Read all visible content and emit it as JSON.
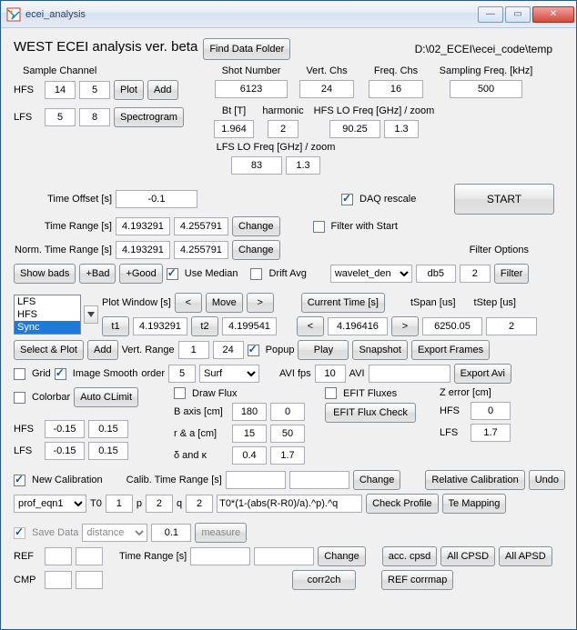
{
  "window": {
    "title": "ecei_analysis"
  },
  "header": {
    "title": "WEST ECEI analysis ver. beta",
    "find_folder": "Find Data Folder",
    "path": "D:\\02_ECEI\\ecei_code\\temp"
  },
  "sample": {
    "label": "Sample Channel",
    "hfs_label": "HFS",
    "hfs1": "14",
    "hfs2": "5",
    "lfs_label": "LFS",
    "lfs1": "5",
    "lfs2": "8",
    "plot": "Plot",
    "add": "Add",
    "spectrogram": "Spectrogram"
  },
  "top": {
    "shot_label": "Shot Number",
    "shot": "6123",
    "vert_label": "Vert. Chs",
    "vert": "24",
    "freq_label": "Freq. Chs",
    "freq": "16",
    "samp_label": "Sampling Freq. [kHz]",
    "samp": "500",
    "bt_label": "Bt [T]",
    "bt": "1.964",
    "harm_label": "harmonic",
    "harm": "2",
    "hfslo_label": "HFS LO Freq [GHz] / zoom",
    "hfslo": "90.25",
    "hfszoom": "1.3",
    "lfslo_label": "LFS LO Freq [GHz] / zoom",
    "lfslo": "83",
    "lfszoom": "1.3"
  },
  "time": {
    "offset_label": "Time Offset [s]",
    "offset": "-0.1",
    "range_label": "Time Range [s]",
    "r1": "4.193291",
    "r2": "4.255791",
    "change": "Change",
    "norm_label": "Norm. Time Range [s]",
    "n1": "4.193291",
    "n2": "4.255791"
  },
  "daq": {
    "rescale": "DAQ rescale",
    "filter_start": "Filter with Start",
    "start": "START"
  },
  "filter": {
    "showbads": "Show bads",
    "plusbad": "+Bad",
    "plusgood": "+Good",
    "use_median": "Use Median",
    "drift_avg": "Drift Avg",
    "options_label": "Filter Options",
    "method": "wavelet_den",
    "param": "db5",
    "n": "2",
    "filter": "Filter"
  },
  "plot": {
    "list": [
      "LFS",
      "HFS",
      "Sync"
    ],
    "window_label": "Plot Window [s]",
    "prev": "<",
    "move": "Move",
    "next": ">",
    "t1_label": "t1",
    "t1": "4.193291",
    "t2_label": "t2",
    "t2": "4.199541",
    "current_label": "Current Time [s]",
    "cur_prev": "<",
    "cur": "4.196416",
    "cur_next": ">",
    "tspan_label": "tSpan [us]",
    "tspan": "6250.05",
    "tstep_label": "tStep [us]",
    "tstep": "2",
    "select_plot": "Select & Plot",
    "add": "Add",
    "vrange_label": "Vert. Range",
    "v1": "1",
    "v2": "24",
    "popup": "Popup",
    "play": "Play",
    "snapshot": "Snapshot",
    "export_frames": "Export Frames",
    "grid": "Grid",
    "smooth": "Image Smooth",
    "order_label": "order",
    "order": "5",
    "surf": "Surf",
    "avifps_label": "AVI fps",
    "avifps": "10",
    "avi_label": "AVI",
    "avi": "",
    "export_avi": "Export Avi",
    "colorbar": "Colorbar",
    "autoclimit": "Auto CLimit",
    "hfs_label": "HFS",
    "h1": "-0.15",
    "h2": "0.15",
    "lfs_label": "LFS",
    "l1": "-0.15",
    "l2": "0.15"
  },
  "flux": {
    "draw": "Draw Flux",
    "efit": "EFIT Fluxes",
    "check": "EFIT Flux Check",
    "baxis_label": "B axis [cm]",
    "b1": "180",
    "b2": "0",
    "ra_label": "r & a [cm]",
    "r1": "15",
    "r2": "50",
    "dk_label": "δ and κ",
    "d1": "0.4",
    "d2": "1.7",
    "zerr_label": "Z error [cm]",
    "zh": "0",
    "zl": "1.7",
    "hfs": "HFS",
    "lfs": "LFS"
  },
  "calib": {
    "new": "New Calibration",
    "range_label": "Calib. Time Range [s]",
    "c1": "",
    "c2": "",
    "change": "Change",
    "rel": "Relative Calibration",
    "undo": "Undo",
    "prof": "prof_eqn1",
    "t0_label": "T0",
    "t0": "1",
    "p_label": "p",
    "p": "2",
    "q_label": "q",
    "q": "2",
    "eqn": "T0*(1-(abs(R-R0)/a).^p).^q",
    "check": "Check Profile",
    "te": "Te Mapping"
  },
  "save": {
    "save": "Save Data",
    "mode": "distance",
    "val": "0.1",
    "measure": "measure",
    "ref_label": "REF",
    "cmp_label": "CMP",
    "tr_label": "Time Range [s]",
    "t1": "",
    "t2": "",
    "change": "Change",
    "acc": "acc. cpsd",
    "allcpsd": "All CPSD",
    "allapsd": "All APSD",
    "corr2ch": "corr2ch",
    "refcorr": "REF corrmap"
  }
}
